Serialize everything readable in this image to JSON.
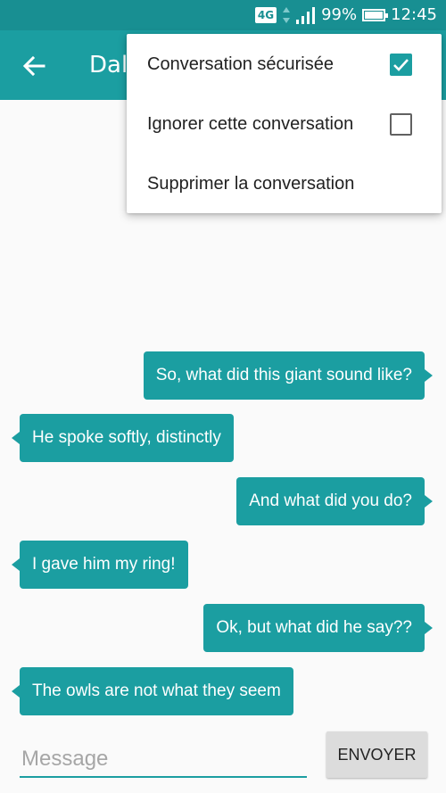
{
  "status_bar": {
    "network": "4G",
    "battery_percent_text": "99%",
    "battery_level": 0.99,
    "time": "12:45"
  },
  "app_bar": {
    "title": "Dal",
    "back_icon": "arrow-left-icon"
  },
  "messages": [
    {
      "direction": "out",
      "text": "So, what did this giant sound like?"
    },
    {
      "direction": "in",
      "text": "He spoke softly, distinctly"
    },
    {
      "direction": "out",
      "text": "And what did you do?"
    },
    {
      "direction": "in",
      "text": "I gave him my ring!"
    },
    {
      "direction": "out",
      "text": "Ok, but what did he say??"
    },
    {
      "direction": "in",
      "text": "The owls are not what they seem"
    }
  ],
  "composer": {
    "placeholder": "Message",
    "send_label": "ENVOYER"
  },
  "menu": {
    "items": [
      {
        "label": "Conversation sécurisée",
        "checkbox": "checked"
      },
      {
        "label": "Ignorer cette conversation",
        "checkbox": "unchecked"
      },
      {
        "label": "Supprimer la conversation",
        "checkbox": "none"
      }
    ]
  },
  "colors": {
    "primary": "#1b9ea1",
    "primary_dark": "#188f92"
  }
}
